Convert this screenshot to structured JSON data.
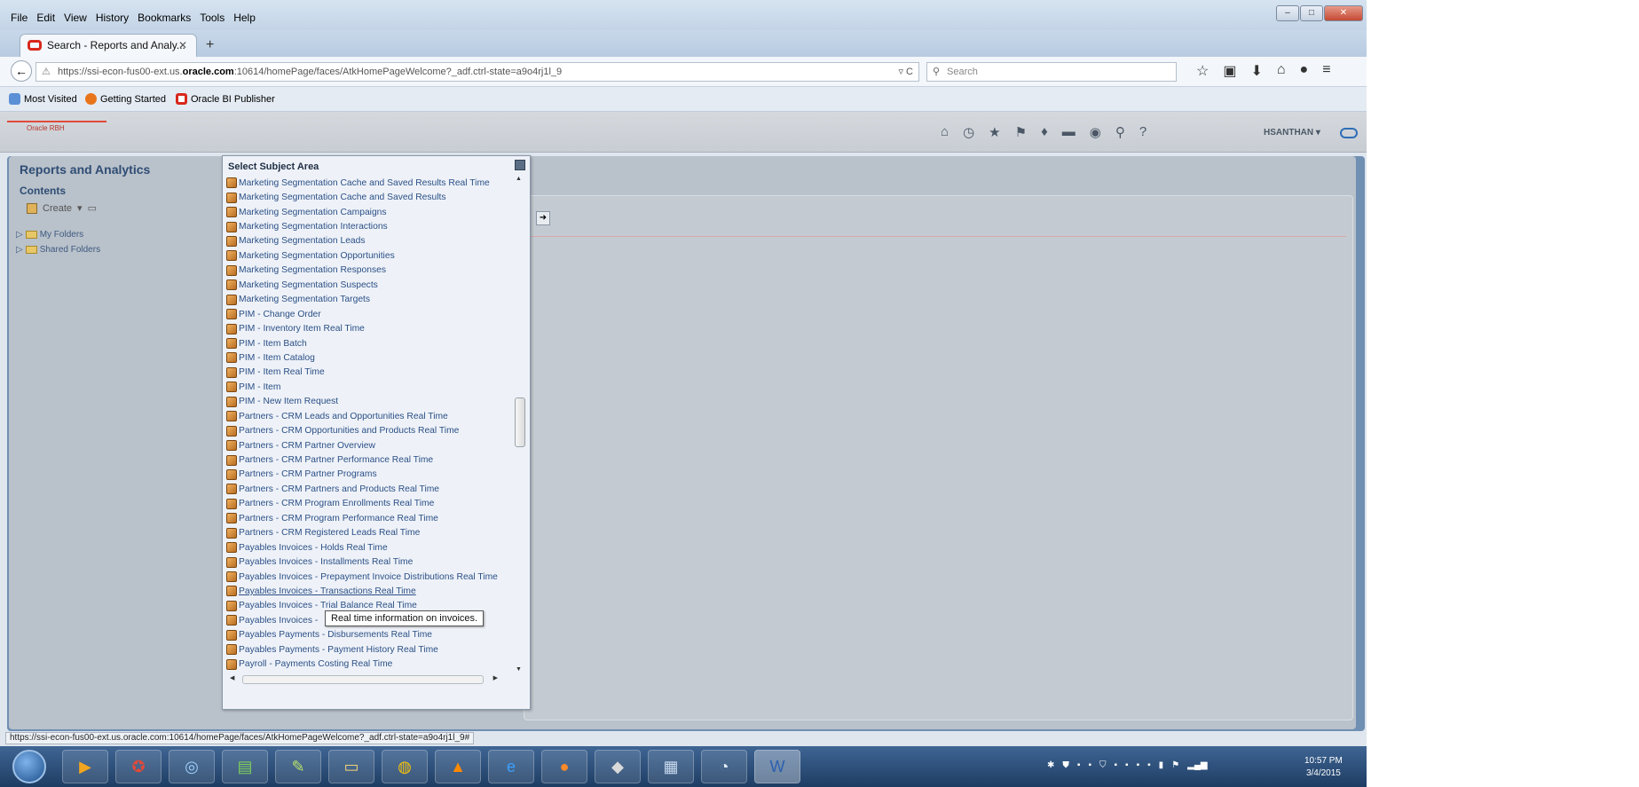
{
  "browser": {
    "menu": [
      "File",
      "Edit",
      "View",
      "History",
      "Bookmarks",
      "Tools",
      "Help"
    ],
    "tab_title": "Search - Reports and Analy...",
    "url_prefix": "https://ssi-econ-fus00-ext.us.",
    "url_domain": "oracle.com",
    "url_suffix": ":10614/homePage/faces/AtkHomePageWelcome?_adf.ctrl-state=a9o4rj1l_9",
    "search_placeholder": "Search",
    "bookmarks": [
      "Most Visited",
      "Getting Started",
      "Oracle BI Publisher"
    ]
  },
  "app": {
    "logo_text": "Oracle RBH",
    "user": "HSANTHAN",
    "left_title": "Reports and Analytics",
    "contents_label": "Contents",
    "create_label": "Create",
    "folders": [
      "My Folders",
      "Shared Folders"
    ]
  },
  "popup": {
    "title": "Select Subject Area",
    "tooltip": "Real time information on invoices.",
    "items": [
      "Marketing Segmentation Cache and Saved Results Real Time",
      "Marketing Segmentation Cache and Saved Results",
      "Marketing Segmentation Campaigns",
      "Marketing Segmentation Interactions",
      "Marketing Segmentation Leads",
      "Marketing Segmentation Opportunities",
      "Marketing Segmentation Responses",
      "Marketing Segmentation Suspects",
      "Marketing Segmentation Targets",
      "PIM - Change Order",
      "PIM - Inventory Item Real Time",
      "PIM - Item Batch",
      "PIM - Item Catalog",
      "PIM - Item Real Time",
      "PIM - Item",
      "PIM - New Item Request",
      "Partners - CRM Leads and Opportunities Real Time",
      "Partners - CRM Opportunities and Products Real Time",
      "Partners - CRM Partner Overview",
      "Partners - CRM Partner Performance Real Time",
      "Partners - CRM Partner Programs",
      "Partners - CRM Partners and Products Real Time",
      "Partners - CRM Program Enrollments Real Time",
      "Partners - CRM Program Performance Real Time",
      "Partners - CRM Registered Leads Real Time",
      "Payables Invoices - Holds Real Time",
      "Payables Invoices - Installments Real Time",
      "Payables Invoices - Prepayment Invoice Distributions Real Time",
      "Payables Invoices - Transactions Real Time",
      "Payables Invoices - Trial Balance Real Time",
      "Payables Invoices -",
      "Payables Payments - Disbursements Real Time",
      "Payables Payments - Payment History Real Time",
      "Payroll - Payments Costing Real Time"
    ]
  },
  "status_url": "https://ssi-econ-fus00-ext.us.oracle.com:10614/homePage/faces/AtkHomePageWelcome?_adf.ctrl-state=a9o4rj1l_9#",
  "clock": {
    "time": "10:57 PM",
    "date": "3/4/2015"
  }
}
